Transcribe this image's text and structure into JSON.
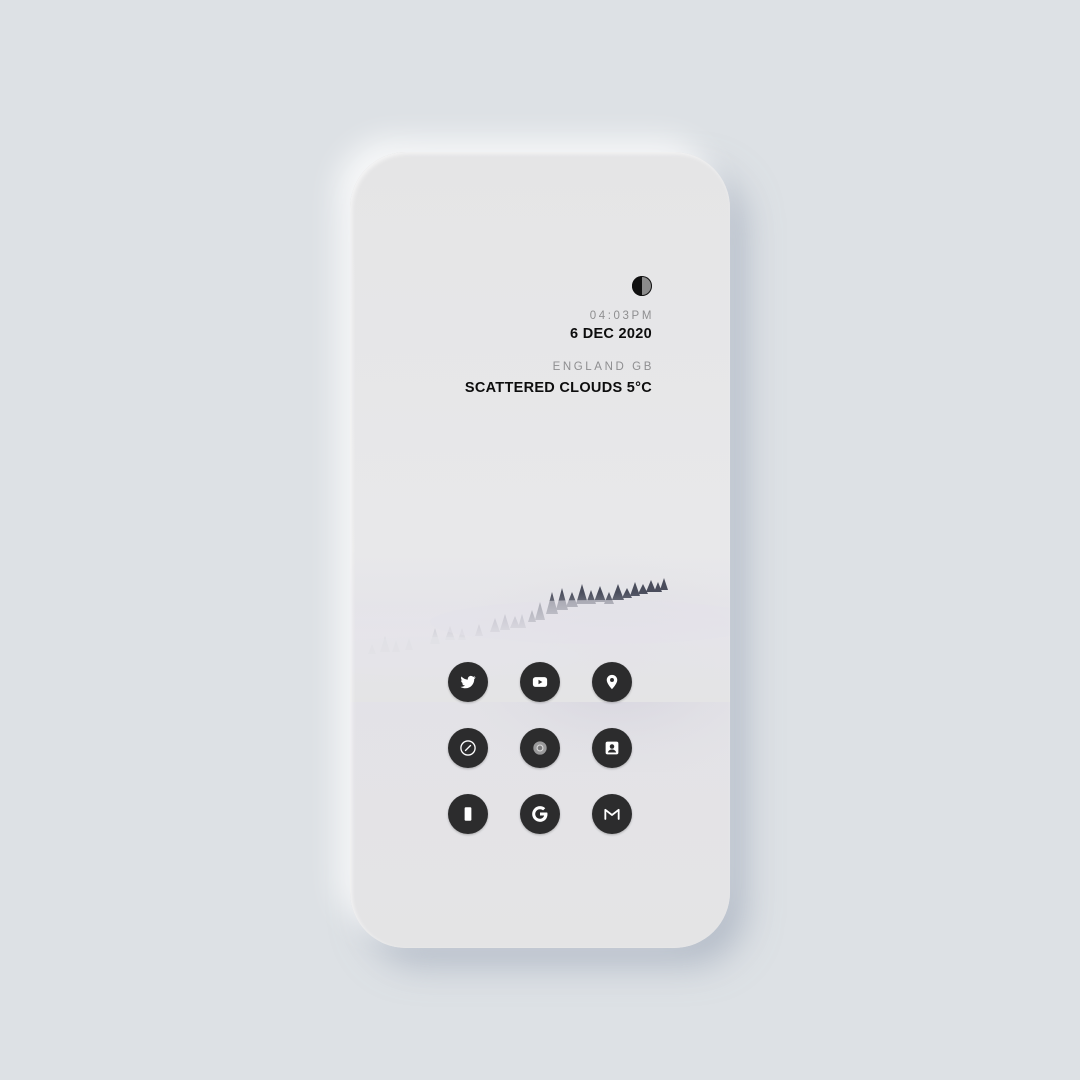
{
  "widget": {
    "time": "04:03PM",
    "date": "6 DEC 2020",
    "location": "ENGLAND GB",
    "weather": "SCATTERED CLOUDS 5°C",
    "moon_icon": "moon-phase-icon"
  },
  "apps": [
    {
      "icon": "twitter-icon"
    },
    {
      "icon": "youtube-icon"
    },
    {
      "icon": "maps-pin-icon"
    },
    {
      "icon": "compass-icon"
    },
    {
      "icon": "chrome-icon"
    },
    {
      "icon": "contacts-icon"
    },
    {
      "icon": "phone-icon"
    },
    {
      "icon": "google-icon"
    },
    {
      "icon": "gmail-icon"
    }
  ],
  "colors": {
    "background": "#dde1e5",
    "phone_screen": "#e4e4e5",
    "icon_circle": "#2c2c2d",
    "primary_text": "#0d0d0d",
    "secondary_text": "#8e8e90"
  }
}
